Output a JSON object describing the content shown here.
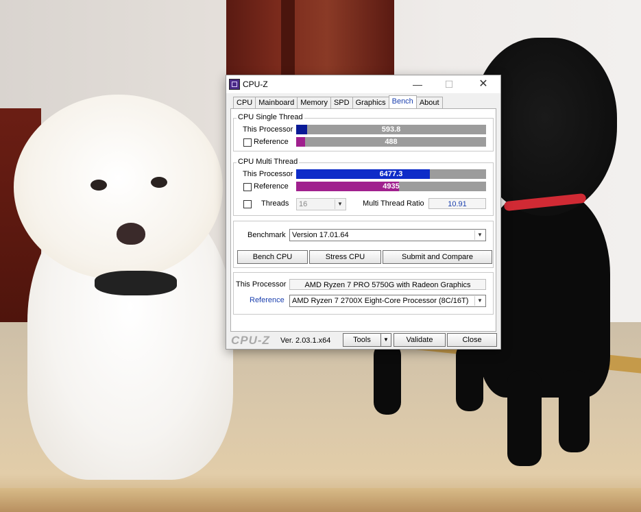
{
  "window": {
    "title": "CPU-Z",
    "min_glyph": "—",
    "max_glyph": "☐",
    "close_glyph": "✕"
  },
  "tabs": [
    {
      "label": "CPU"
    },
    {
      "label": "Mainboard"
    },
    {
      "label": "Memory"
    },
    {
      "label": "SPD"
    },
    {
      "label": "Graphics"
    },
    {
      "label": "Bench"
    },
    {
      "label": "About"
    }
  ],
  "active_tab": "Bench",
  "single_thread": {
    "group_label": "CPU Single Thread",
    "this_label": "This Processor",
    "this_value": "593.8",
    "this_fraction": 0.059,
    "ref_label": "Reference",
    "ref_value": "488",
    "ref_fraction": 0.048,
    "ref_checked": false
  },
  "multi_thread": {
    "group_label": "CPU Multi Thread",
    "this_label": "This Processor",
    "this_value": "6477.3",
    "this_fraction": 0.705,
    "ref_label": "Reference",
    "ref_value": "4935",
    "ref_fraction": 0.542,
    "ref_checked": false,
    "threads_label": "Threads",
    "threads_value": "16",
    "threads_checked": false,
    "ratio_label": "Multi Thread Ratio",
    "ratio_value": "10.91"
  },
  "benchmark": {
    "label": "Benchmark",
    "version": "Version 17.01.64",
    "bench_cpu": "Bench CPU",
    "stress_cpu": "Stress CPU",
    "submit": "Submit and Compare"
  },
  "processors": {
    "this_label": "This Processor",
    "this_value": "AMD Ryzen 7 PRO 5750G with Radeon Graphics",
    "ref_label": "Reference",
    "ref_value": "AMD Ryzen 7 2700X Eight-Core Processor (8C/16T)"
  },
  "footer": {
    "logo": "CPU-Z",
    "version": "Ver. 2.03.1.x64",
    "tools": "Tools",
    "validate": "Validate",
    "close": "Close"
  },
  "colors": {
    "this_bar": "#0a1a96",
    "this_bar_multi": "#0e2cc8",
    "ref_bar": "#a0208e",
    "bar_bg": "#9c9c9c",
    "reference_link": "#1a3fae"
  },
  "icons": {
    "dropdown": "▼"
  }
}
